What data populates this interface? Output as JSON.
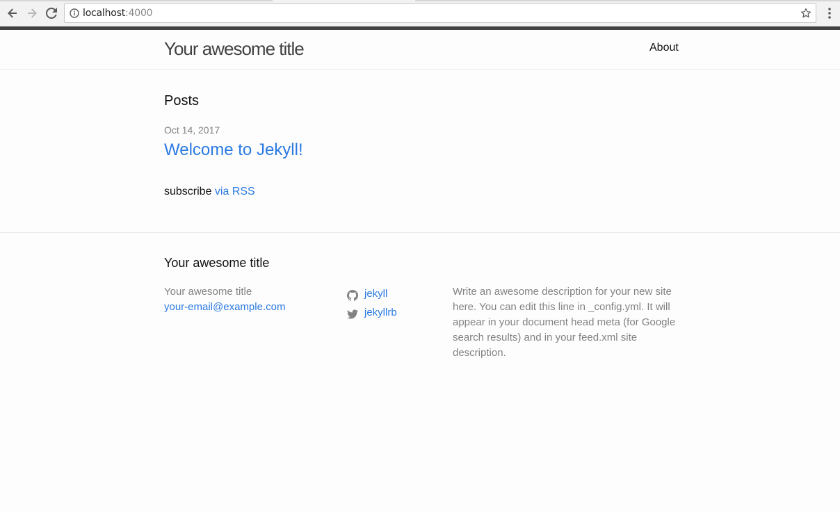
{
  "browser": {
    "url_host": "localhost",
    "url_port": ":4000",
    "icons": [
      "back-arrow-icon",
      "forward-arrow-icon",
      "reload-icon",
      "info-icon",
      "star-icon",
      "menu-dots-icon"
    ]
  },
  "header": {
    "site_title": "Your awesome title",
    "nav": [
      {
        "label": "About"
      }
    ]
  },
  "main": {
    "heading": "Posts",
    "posts": [
      {
        "date": "Oct 14, 2017",
        "title": "Welcome to Jekyll!"
      }
    ],
    "rss_prefix": "subscribe ",
    "rss_link": "via RSS"
  },
  "footer": {
    "heading": "Your awesome title",
    "name": "Your awesome title",
    "email": "your-email@example.com",
    "social": [
      {
        "icon": "github-icon",
        "label": "jekyll"
      },
      {
        "icon": "twitter-icon",
        "label": "jekyllrb"
      }
    ],
    "description": "Write an awesome description for your new site here. You can edit this line in _config.yml. It will appear in your document head meta (for Google search results) and in your feed.xml site description."
  },
  "colors": {
    "link": "#2a7ae2",
    "text": "#111111",
    "muted": "#828282",
    "title": "#424242",
    "background": "#fdfdfd"
  }
}
